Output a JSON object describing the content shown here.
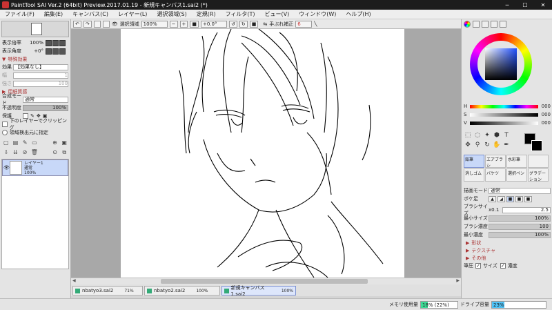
{
  "window": {
    "title": "PaintTool SAI Ver.2 (64bit) Preview.2017.01.19 - 新規キャンバス1.sai2 (*)",
    "controls": [
      "─",
      "☐",
      "✕"
    ]
  },
  "menu": [
    "ファイル(F)",
    "編集(E)",
    "キャンバス(C)",
    "レイヤー(L)",
    "選択領域(S)",
    "定規(R)",
    "フィルタ(T)",
    "ビュー(V)",
    "ウィンドウ(W)",
    "ヘルプ(H)"
  ],
  "left": {
    "zoom_label": "表示倍率",
    "zoom_value": "100%",
    "angle_label": "表示角度",
    "angle_value": "+0°",
    "effects_title": "特殊効果",
    "effect_label": "効果",
    "effect_value": "【効果なし】",
    "width_label": "幅",
    "width_value": "1",
    "strength_label": "強さ",
    "strength_value": "100",
    "paper_title": "用紙質感",
    "blend_label": "合成モード",
    "blend_value": "通常",
    "opacity_label": "不透明度",
    "opacity_value": "100%",
    "protect_label": "保護",
    "clip_label": "下のレイヤーでクリッピング",
    "select_source_label": "領域検出元に指定",
    "layer": {
      "name": "レイヤー1",
      "mode": "通常",
      "opacity": "100%"
    }
  },
  "toolbar": {
    "select_label": "選択領域",
    "zoom": "100%",
    "angle": "+0.0°",
    "stabilizer_label": "手ぶれ補正",
    "stabilizer_value": "6"
  },
  "tabs": [
    {
      "name": "nbatyo3.sai2",
      "pct": "71%"
    },
    {
      "name": "nbatyo2.sai2",
      "pct": "100%"
    },
    {
      "name": "新規キャンバス1.sai2",
      "pct": "100%"
    }
  ],
  "right": {
    "hsv": [
      {
        "key": "H",
        "value": "000"
      },
      {
        "key": "S",
        "value": "000"
      },
      {
        "key": "V",
        "value": "000"
      }
    ],
    "brushes": [
      "鉛筆",
      "エアブラシ",
      "水彩筆",
      "",
      "消しゴム",
      "バケツ",
      "選択ペン",
      "グラデーション"
    ],
    "draw_mode_label": "描画モード",
    "draw_mode_value": "通常",
    "shape_label": "ボケ足",
    "brush_size_label": "ブラシサイズ",
    "brush_size_mult": "x0.1",
    "brush_size_value": "2.5",
    "min_size_label": "最小サイズ",
    "min_size_value": "100%",
    "brush_density_label": "ブラシ濃度",
    "brush_density_value": "100",
    "min_density_label": "最小濃度",
    "min_density_value": "100%",
    "shape_section": "形状",
    "texture_section": "テクスチャ",
    "other_section": "その他",
    "pressure_label": "筆圧",
    "size_check": "サイズ",
    "density_check": "濃度"
  },
  "status": {
    "memory_label": "メモリ使用量",
    "memory_value": "18%",
    "memory_extra": "(22%)",
    "memory_fraction": 0.18,
    "drive_label": "ドライブ容量",
    "drive_value": "23%",
    "drive_fraction": 0.23
  },
  "colors": {
    "fg": "#000000",
    "bg": "#000000"
  }
}
